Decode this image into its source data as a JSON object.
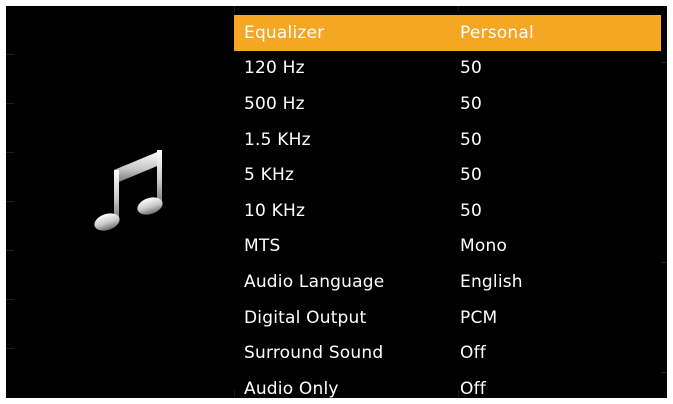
{
  "colors": {
    "background": "#000000",
    "highlight": "#f5a623",
    "text": "#ffffff"
  },
  "icon": "music-note-icon",
  "menu": {
    "items": [
      {
        "label": "Equalizer",
        "value": "Personal",
        "selected": true
      },
      {
        "label": "120 Hz",
        "value": "50"
      },
      {
        "label": "500 Hz",
        "value": "50"
      },
      {
        "label": "1.5 KHz",
        "value": "50"
      },
      {
        "label": "5 KHz",
        "value": "50"
      },
      {
        "label": "10 KHz",
        "value": "50"
      },
      {
        "label": "MTS",
        "value": "Mono"
      },
      {
        "label": "Audio Language",
        "value": "English"
      },
      {
        "label": "Digital Output",
        "value": "PCM"
      },
      {
        "label": "Surround Sound",
        "value": "Off"
      },
      {
        "label": "Audio Only",
        "value": "Off"
      }
    ]
  }
}
